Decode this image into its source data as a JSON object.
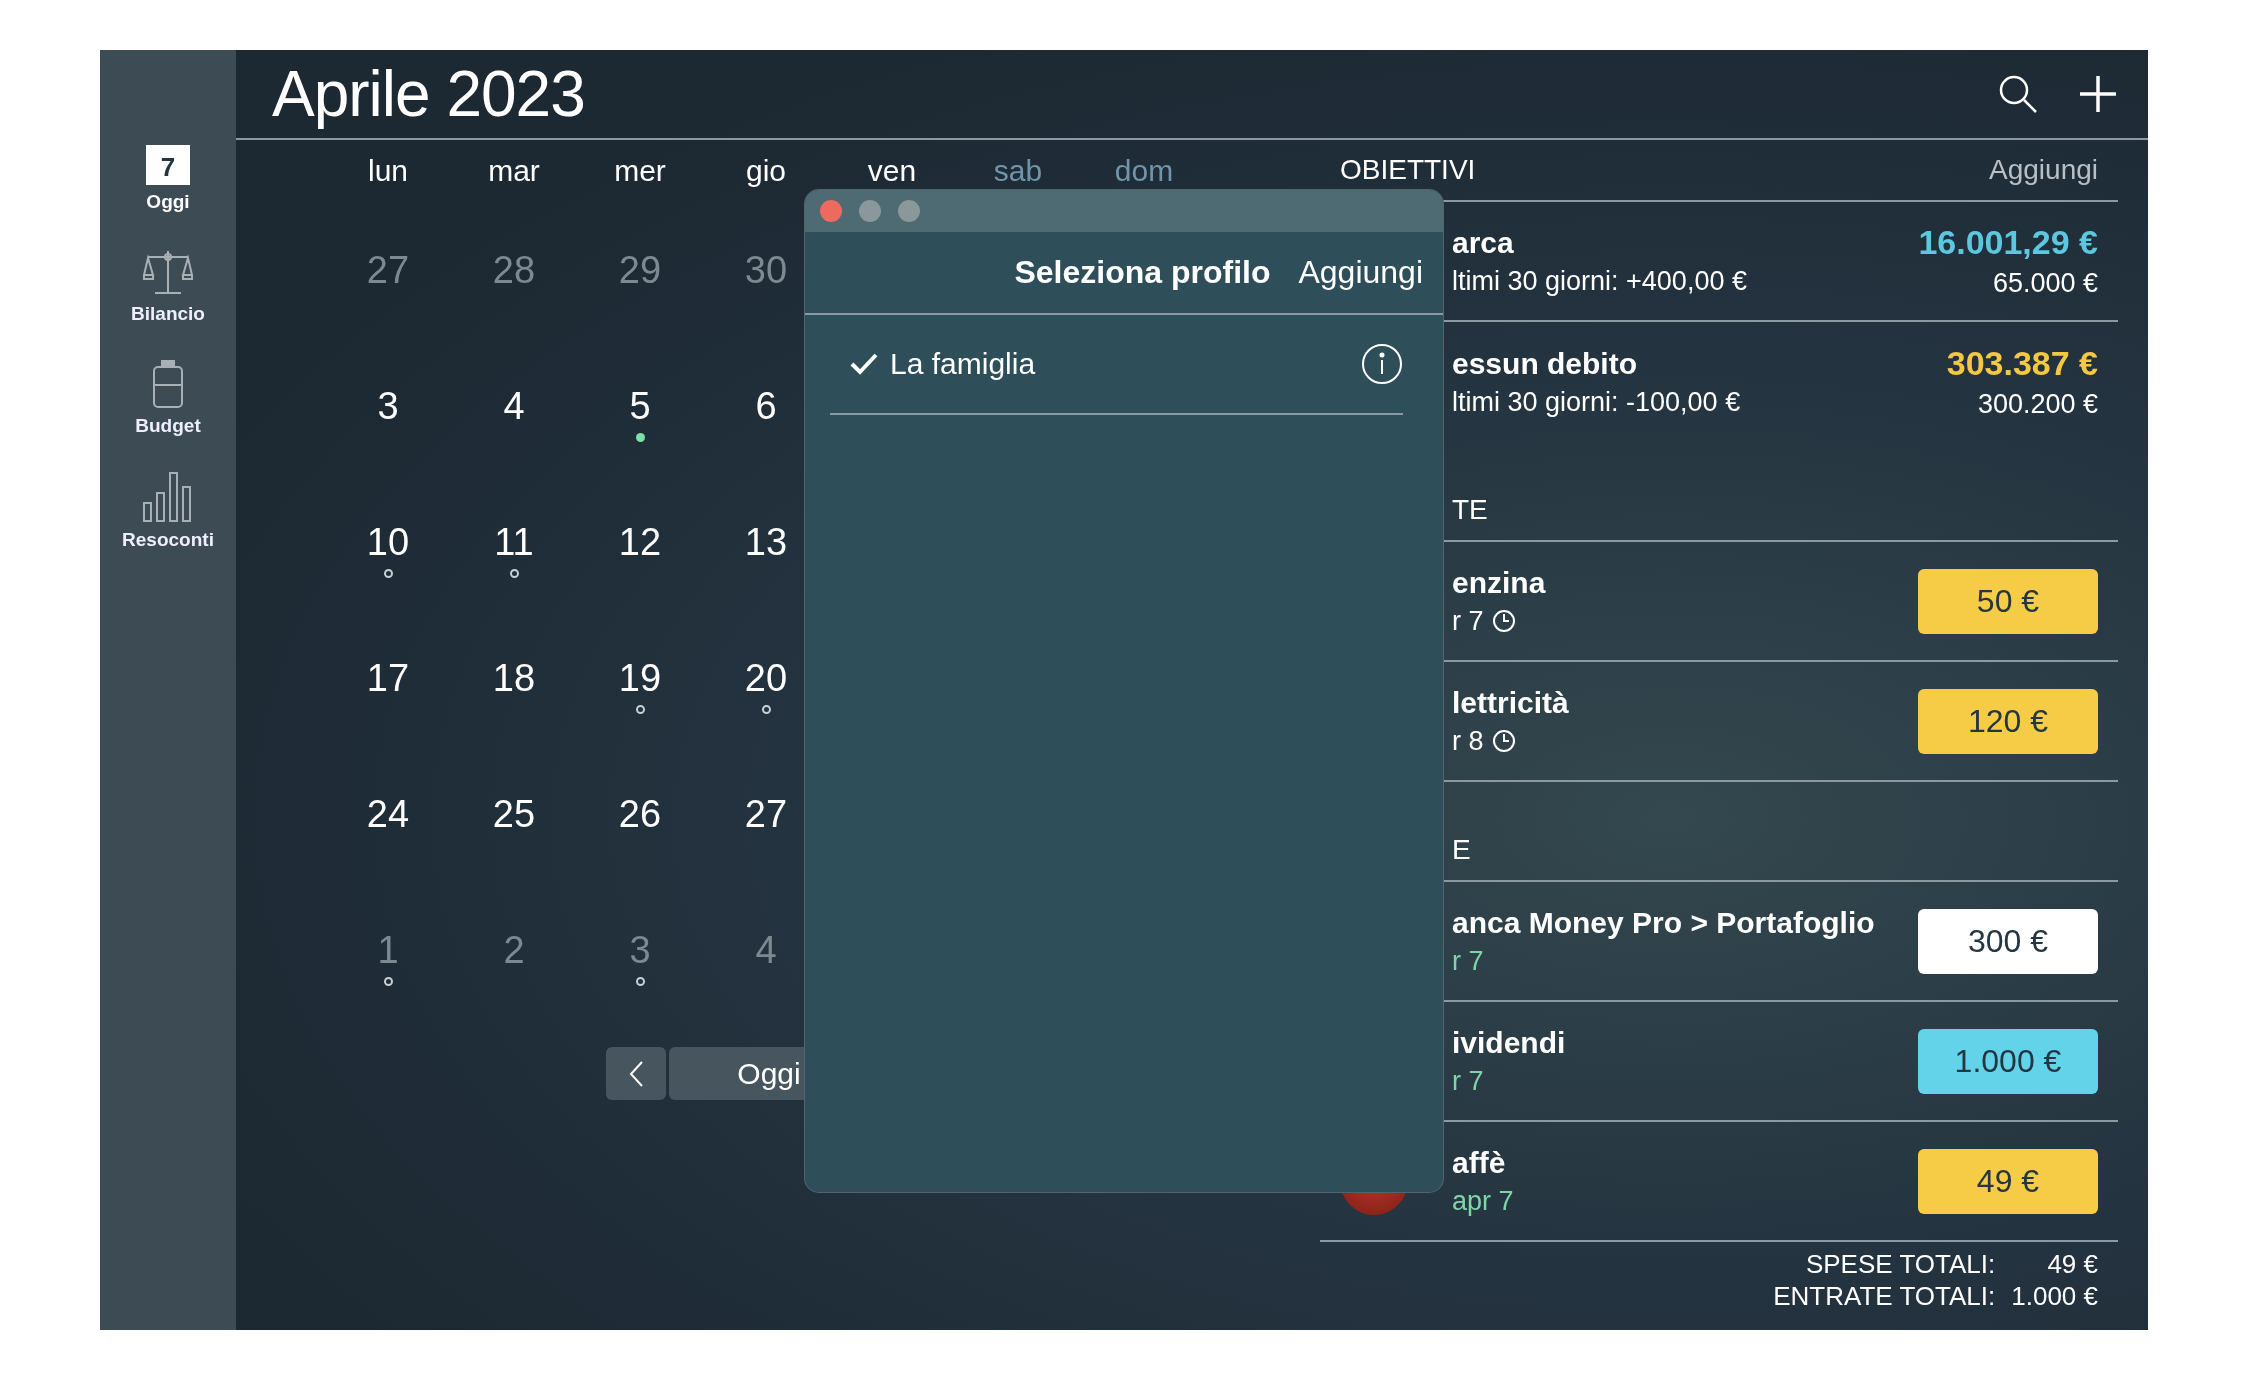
{
  "sidebar": {
    "items": [
      {
        "kind": "calendar",
        "label": "Oggi",
        "icon_day": "7",
        "selected": true
      },
      {
        "kind": "scales",
        "label": "Bilancio",
        "selected": false
      },
      {
        "kind": "jar",
        "label": "Budget",
        "selected": false
      },
      {
        "kind": "bars",
        "label": "Resoconti",
        "selected": false
      }
    ]
  },
  "header": {
    "title": "Aprile 2023"
  },
  "calendar": {
    "weekdays": [
      {
        "label": "lun",
        "weekend": false
      },
      {
        "label": "mar",
        "weekend": false
      },
      {
        "label": "mer",
        "weekend": false
      },
      {
        "label": "gio",
        "weekend": false
      },
      {
        "label": "ven",
        "weekend": false
      },
      {
        "label": "sab",
        "weekend": true
      },
      {
        "label": "dom",
        "weekend": true
      }
    ],
    "weeks": [
      {
        "days": [
          {
            "day": "27",
            "muted": true,
            "kind": "plain"
          },
          {
            "day": "28",
            "muted": true,
            "kind": "plain"
          },
          {
            "day": "29",
            "muted": true,
            "kind": "plain"
          },
          {
            "day": "30",
            "muted": true,
            "kind": "plain"
          }
        ]
      },
      {
        "days": [
          {
            "day": "3",
            "muted": false,
            "kind": "plain"
          },
          {
            "day": "4",
            "muted": false,
            "kind": "plain"
          },
          {
            "day": "5",
            "muted": false,
            "kind": "dot"
          },
          {
            "day": "6",
            "muted": false,
            "kind": "plain"
          }
        ]
      },
      {
        "days": [
          {
            "day": "10",
            "muted": false,
            "kind": "ring"
          },
          {
            "day": "11",
            "muted": false,
            "kind": "ring"
          },
          {
            "day": "12",
            "muted": false,
            "kind": "plain"
          },
          {
            "day": "13",
            "muted": false,
            "kind": "plain"
          }
        ]
      },
      {
        "days": [
          {
            "day": "17",
            "muted": false,
            "kind": "plain"
          },
          {
            "day": "18",
            "muted": false,
            "kind": "plain"
          },
          {
            "day": "19",
            "muted": false,
            "kind": "ring"
          },
          {
            "day": "20",
            "muted": false,
            "kind": "ring"
          }
        ]
      },
      {
        "days": [
          {
            "day": "24",
            "muted": false,
            "kind": "plain"
          },
          {
            "day": "25",
            "muted": false,
            "kind": "plain"
          },
          {
            "day": "26",
            "muted": false,
            "kind": "plain"
          },
          {
            "day": "27",
            "muted": false,
            "kind": "plain"
          }
        ]
      },
      {
        "days": [
          {
            "day": "1",
            "muted": true,
            "kind": "ring"
          },
          {
            "day": "2",
            "muted": true,
            "kind": "plain"
          },
          {
            "day": "3",
            "muted": true,
            "kind": "ring"
          },
          {
            "day": "4",
            "muted": true,
            "kind": "plain"
          }
        ]
      }
    ],
    "today_button": "Oggi"
  },
  "panel": {
    "goals_section": {
      "title": "OBIETTIVI",
      "action": "Aggiungi"
    },
    "goals": [
      {
        "name": "arca",
        "subtitle": "ltimi 30 giorni: +400,00 €",
        "amount": "16.001,29 €",
        "color": "#5bc8e0",
        "target": "65.000 €"
      },
      {
        "name": "essun debito",
        "subtitle": "ltimi 30 giorni: -100,00 €",
        "amount": "303.387 €",
        "color": "#f5c842",
        "target": "300.200 €"
      }
    ],
    "sections": [
      {
        "title": "TE",
        "rows": [
          {
            "kind": "scheduled",
            "name": "enzina",
            "date": "r 7",
            "amount": "50 €",
            "color": "#f6cb45"
          },
          {
            "kind": "scheduled",
            "name": "lettricità",
            "date": "r 8",
            "amount": "120 €",
            "color": "#f6cb45"
          }
        ]
      },
      {
        "title": "E",
        "rows": [
          {
            "kind": "paid",
            "name": "anca Money Pro > Portafoglio",
            "date": "r 7",
            "amount": "300 €",
            "color": "#ffffff"
          },
          {
            "kind": "paid",
            "name": "ividendi",
            "date": "r 7",
            "amount": "1.000 €",
            "color": "#62d3e8"
          },
          {
            "kind": "paid",
            "name": "affè",
            "date": "apr 7",
            "amount": "49 €",
            "color": "#f6cb45",
            "icon": true
          }
        ]
      }
    ],
    "totals": [
      {
        "label": "SPESE TOTALI:",
        "value": "49 €"
      },
      {
        "label": "ENTRATE TOTALI:",
        "value": "1.000 €"
      }
    ]
  },
  "modal": {
    "title": "Seleziona profilo",
    "action": "Aggiungi",
    "profiles": [
      {
        "name": "La famiglia",
        "selected": true
      }
    ]
  }
}
